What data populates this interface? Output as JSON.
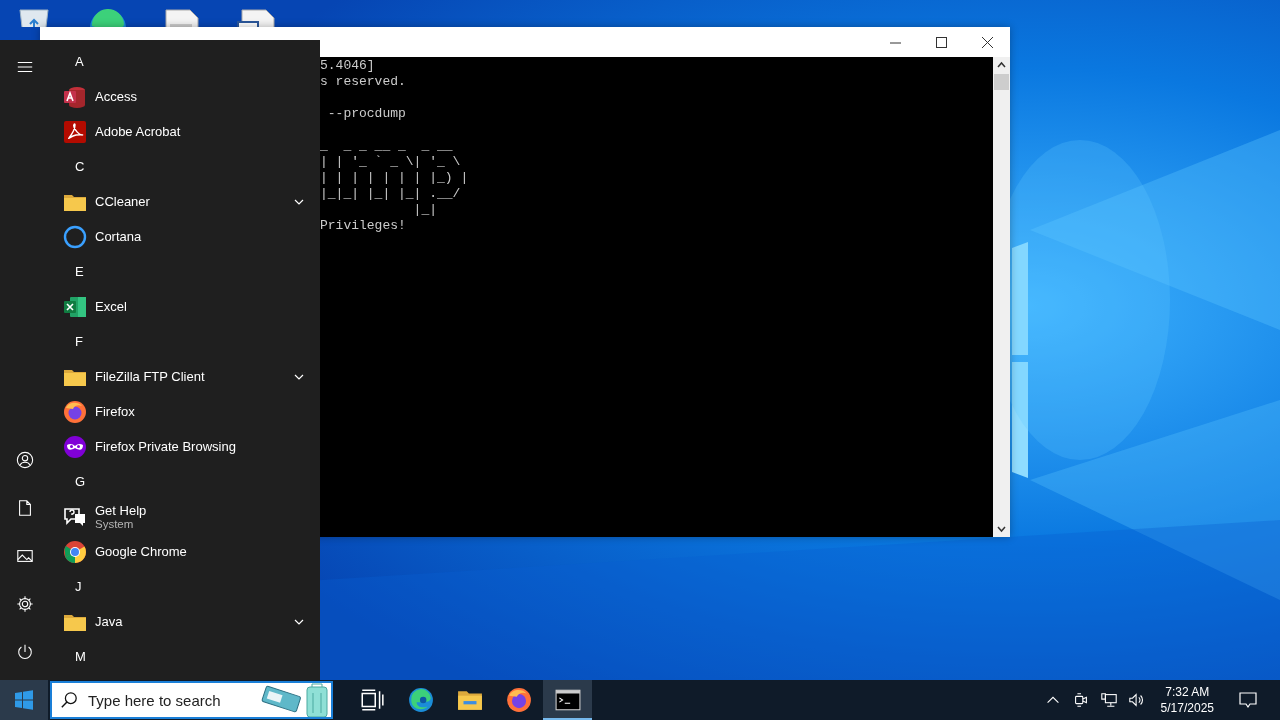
{
  "desktop_icons": [
    {
      "kind": "recycle-bin"
    },
    {
      "kind": "edge"
    },
    {
      "kind": "document"
    },
    {
      "kind": "word-document"
    }
  ],
  "console": {
    "blocks": [
      [
        "5.4046]",
        "s reserved."
      ],
      [
        " --procdump"
      ],
      [
        "_  _ _ __ _  _ __",
        "| | '_ ` _ \\| '_ \\",
        "| | | | | | | |_) |",
        "|_|_| |_| |_| .__/",
        "            |_|",
        "Privileges!"
      ]
    ]
  },
  "start_menu": {
    "rail": [
      {
        "kind": "menu"
      },
      {
        "kind": "user"
      },
      {
        "kind": "document"
      },
      {
        "kind": "pictures"
      },
      {
        "kind": "settings"
      },
      {
        "kind": "power"
      }
    ],
    "groups": [
      {
        "letter": "A",
        "apps": [
          {
            "name": "Access",
            "kind": "access",
            "expandable": false
          },
          {
            "name": "Adobe Acrobat",
            "kind": "acrobat",
            "expandable": false
          }
        ]
      },
      {
        "letter": "C",
        "apps": [
          {
            "name": "CCleaner",
            "kind": "folder",
            "expandable": true
          },
          {
            "name": "Cortana",
            "kind": "cortana",
            "expandable": false
          }
        ]
      },
      {
        "letter": "E",
        "apps": [
          {
            "name": "Excel",
            "kind": "excel",
            "expandable": false
          }
        ]
      },
      {
        "letter": "F",
        "apps": [
          {
            "name": "FileZilla FTP Client",
            "kind": "folder",
            "expandable": true
          },
          {
            "name": "Firefox",
            "kind": "firefox",
            "expandable": false
          },
          {
            "name": "Firefox Private Browsing",
            "kind": "firefox-private",
            "expandable": false
          }
        ]
      },
      {
        "letter": "G",
        "apps": [
          {
            "name": "Get Help",
            "subtitle": "System",
            "kind": "help",
            "expandable": false
          },
          {
            "name": "Google Chrome",
            "kind": "chrome",
            "expandable": false
          }
        ]
      },
      {
        "letter": "J",
        "apps": [
          {
            "name": "Java",
            "kind": "folder",
            "expandable": true
          }
        ]
      },
      {
        "letter": "M"
      }
    ]
  },
  "taskbar": {
    "search": {
      "placeholder": "Type here to search"
    },
    "apps": [
      {
        "kind": "task-view",
        "active": false
      },
      {
        "kind": "edge",
        "active": false
      },
      {
        "kind": "explorer",
        "active": false
      },
      {
        "kind": "firefox",
        "active": false
      },
      {
        "kind": "terminal",
        "active": true
      }
    ],
    "tray": [
      {
        "kind": "chevron"
      },
      {
        "kind": "meet"
      },
      {
        "kind": "network"
      },
      {
        "kind": "volume"
      }
    ],
    "time": "7:32 AM",
    "date": "5/17/2025"
  }
}
